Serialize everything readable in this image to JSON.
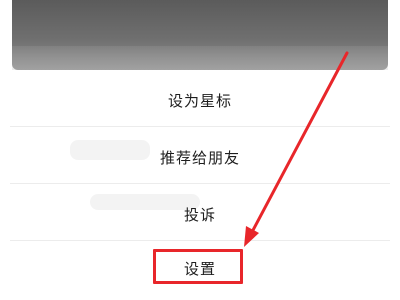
{
  "menu": {
    "items": [
      {
        "label": "设为星标"
      },
      {
        "label": "推荐给朋友"
      },
      {
        "label": "投诉"
      },
      {
        "label": "设置"
      }
    ]
  },
  "annotation": {
    "highlighted_item": "设置",
    "color": "#e8262a"
  }
}
